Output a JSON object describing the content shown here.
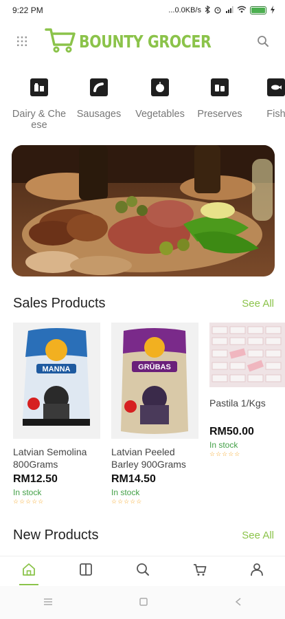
{
  "status_bar": {
    "time": "9:22 PM",
    "network_speed": "...0.0KB/s",
    "icons": [
      "bluetooth-icon",
      "alarm-icon",
      "sim-icon",
      "wifi-icon",
      "battery-icon",
      "charging-icon"
    ],
    "battery_level": 1.0
  },
  "header": {
    "menu_icon": "grid-menu-icon",
    "logo_icon": "cart-icon",
    "title": "BOUNTY GROCER",
    "search_icon": "search-icon"
  },
  "categories": [
    {
      "label": "Dairy & Cheese",
      "icon": "dairy-icon"
    },
    {
      "label": "Sausages",
      "icon": "sausages-icon"
    },
    {
      "label": "Vegetables",
      "icon": "vegetables-icon"
    },
    {
      "label": "Preserves",
      "icon": "preserves-icon"
    },
    {
      "label": "Fish",
      "icon": "fish-icon"
    }
  ],
  "sales_section": {
    "title": "Sales Products",
    "see_all": "See All"
  },
  "sales_products": [
    {
      "name": "Latvian Semolina 800Grams",
      "price": "RM12.50",
      "stock": "In stock",
      "rating": 5,
      "pack_label": "MANNA"
    },
    {
      "name": "Latvian Peeled Barley 900Grams",
      "price": "RM14.50",
      "stock": "In stock",
      "rating": 5,
      "pack_label": "GRŪBAS"
    },
    {
      "name": "Pastila 1/Kgs",
      "price": "RM50.00",
      "stock": "In stock",
      "rating": 5
    }
  ],
  "new_section": {
    "title": "New Products",
    "see_all": "See All"
  },
  "bottom_nav": [
    {
      "icon": "home-icon",
      "active": true
    },
    {
      "icon": "catalog-icon",
      "active": false
    },
    {
      "icon": "search-icon",
      "active": false
    },
    {
      "icon": "cart-icon",
      "active": false
    },
    {
      "icon": "profile-icon",
      "active": false
    }
  ],
  "colors": {
    "accent": "#8bc34a",
    "in_stock": "#43a047",
    "star": "#f5a623"
  }
}
